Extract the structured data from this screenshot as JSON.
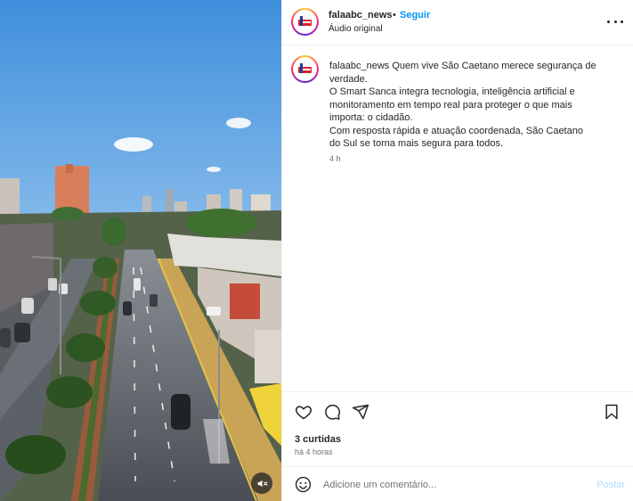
{
  "post": {
    "username": "falaabc_news",
    "follow_label": "Seguir",
    "separator": "•",
    "audio_label": "Áudio original"
  },
  "caption": {
    "username": "falaabc_news",
    "line1": "Quem vive São Caetano merece segurança de verdade.",
    "line2": "O Smart Sanca integra tecnologia, inteligência artificial e monitoramento em tempo real para proteger o que mais importa: o cidadão.",
    "line3": "Com resposta rápida e atuação coordenada, São Caetano do Sul se torna mais segura para todos.",
    "time": "4 h"
  },
  "stats": {
    "likes": "3 curtidas",
    "posted_ago": "há 4 horas"
  },
  "comment": {
    "placeholder": "Adicione um comentário...",
    "post_label": "Postar"
  },
  "icons": {
    "more": "more-horizontal-icon",
    "like": "heart-icon",
    "comment": "comment-icon",
    "share": "send-icon",
    "save": "bookmark-icon",
    "emoji": "emoji-icon",
    "mute": "speaker-muted-icon"
  },
  "colors": {
    "link_blue": "#0095f6",
    "post_disabled": "#b3dbff",
    "secondary_text": "#737373"
  }
}
